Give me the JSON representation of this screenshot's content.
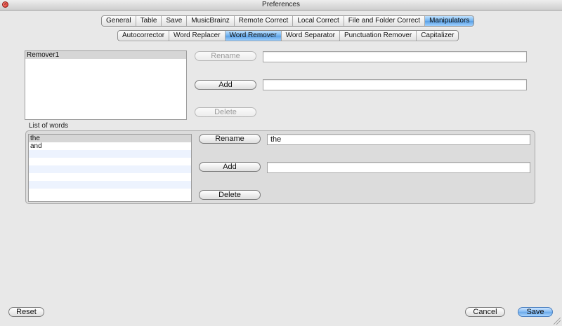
{
  "window": {
    "title": "Preferences"
  },
  "main_tabs": [
    {
      "label": "General"
    },
    {
      "label": "Table"
    },
    {
      "label": "Save"
    },
    {
      "label": "MusicBrainz"
    },
    {
      "label": "Remote Correct"
    },
    {
      "label": "Local Correct"
    },
    {
      "label": "File and Folder Correct"
    },
    {
      "label": "Manipulators",
      "selected": true
    }
  ],
  "sub_tabs": [
    {
      "label": "Autocorrector"
    },
    {
      "label": "Word Replacer"
    },
    {
      "label": "Word Remover",
      "selected": true
    },
    {
      "label": "Word Separator"
    },
    {
      "label": "Punctuation Remover"
    },
    {
      "label": "Capitalizer"
    }
  ],
  "remover_section": {
    "list_items": [
      "Remover1"
    ],
    "rename_label": "Rename",
    "add_label": "Add",
    "delete_label": "Delete",
    "rename_value": "",
    "add_value": ""
  },
  "words_section": {
    "group_label": "List of words",
    "words": [
      "the",
      "and"
    ],
    "rename_label": "Rename",
    "add_label": "Add",
    "delete_label": "Delete",
    "rename_value": "the",
    "add_value": ""
  },
  "footer": {
    "reset_label": "Reset",
    "cancel_label": "Cancel",
    "save_label": "Save"
  },
  "colors": {
    "selected_tab": "#6fb0ee",
    "window_bg": "#e8e8e8"
  }
}
